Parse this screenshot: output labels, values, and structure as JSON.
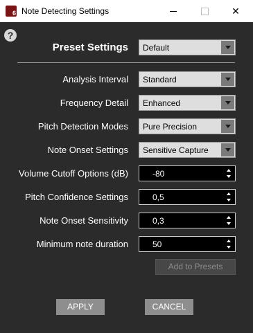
{
  "window": {
    "title": "Note Detecting Settings",
    "app_icon_glyph": "6",
    "minimize_icon": "minimize-icon",
    "maximize_icon": "maximize-icon",
    "close_glyph": "✕"
  },
  "help": {
    "glyph": "?"
  },
  "preset": {
    "label": "Preset Settings",
    "value": "Default"
  },
  "fields": {
    "analysis_interval": {
      "label": "Analysis Interval",
      "value": "Standard"
    },
    "frequency_detail": {
      "label": "Frequency Detail",
      "value": "Enhanced"
    },
    "pitch_detection_modes": {
      "label": "Pitch Detection Modes",
      "value": "Pure Precision"
    },
    "note_onset_settings": {
      "label": "Note Onset Settings",
      "value": "Sensitive Capture"
    },
    "volume_cutoff": {
      "label": "Volume Cutoff Options (dB)",
      "value": "-80"
    },
    "pitch_confidence": {
      "label": "Pitch Confidence Settings",
      "value": "0,5"
    },
    "note_onset_sensitivity": {
      "label": "Note Onset Sensitivity",
      "value": "0,3"
    },
    "minimum_note_duration": {
      "label": "Minimum note duration",
      "value": "50"
    }
  },
  "buttons": {
    "add_to_presets": "Add to Presets",
    "apply": "APPLY",
    "cancel": "CANCEL"
  },
  "colors": {
    "background": "#2b2b2b",
    "titlebar": "#ffffff",
    "select_bg": "#dedede",
    "spin_bg": "#000000",
    "button_bg": "#8e8e8e"
  }
}
